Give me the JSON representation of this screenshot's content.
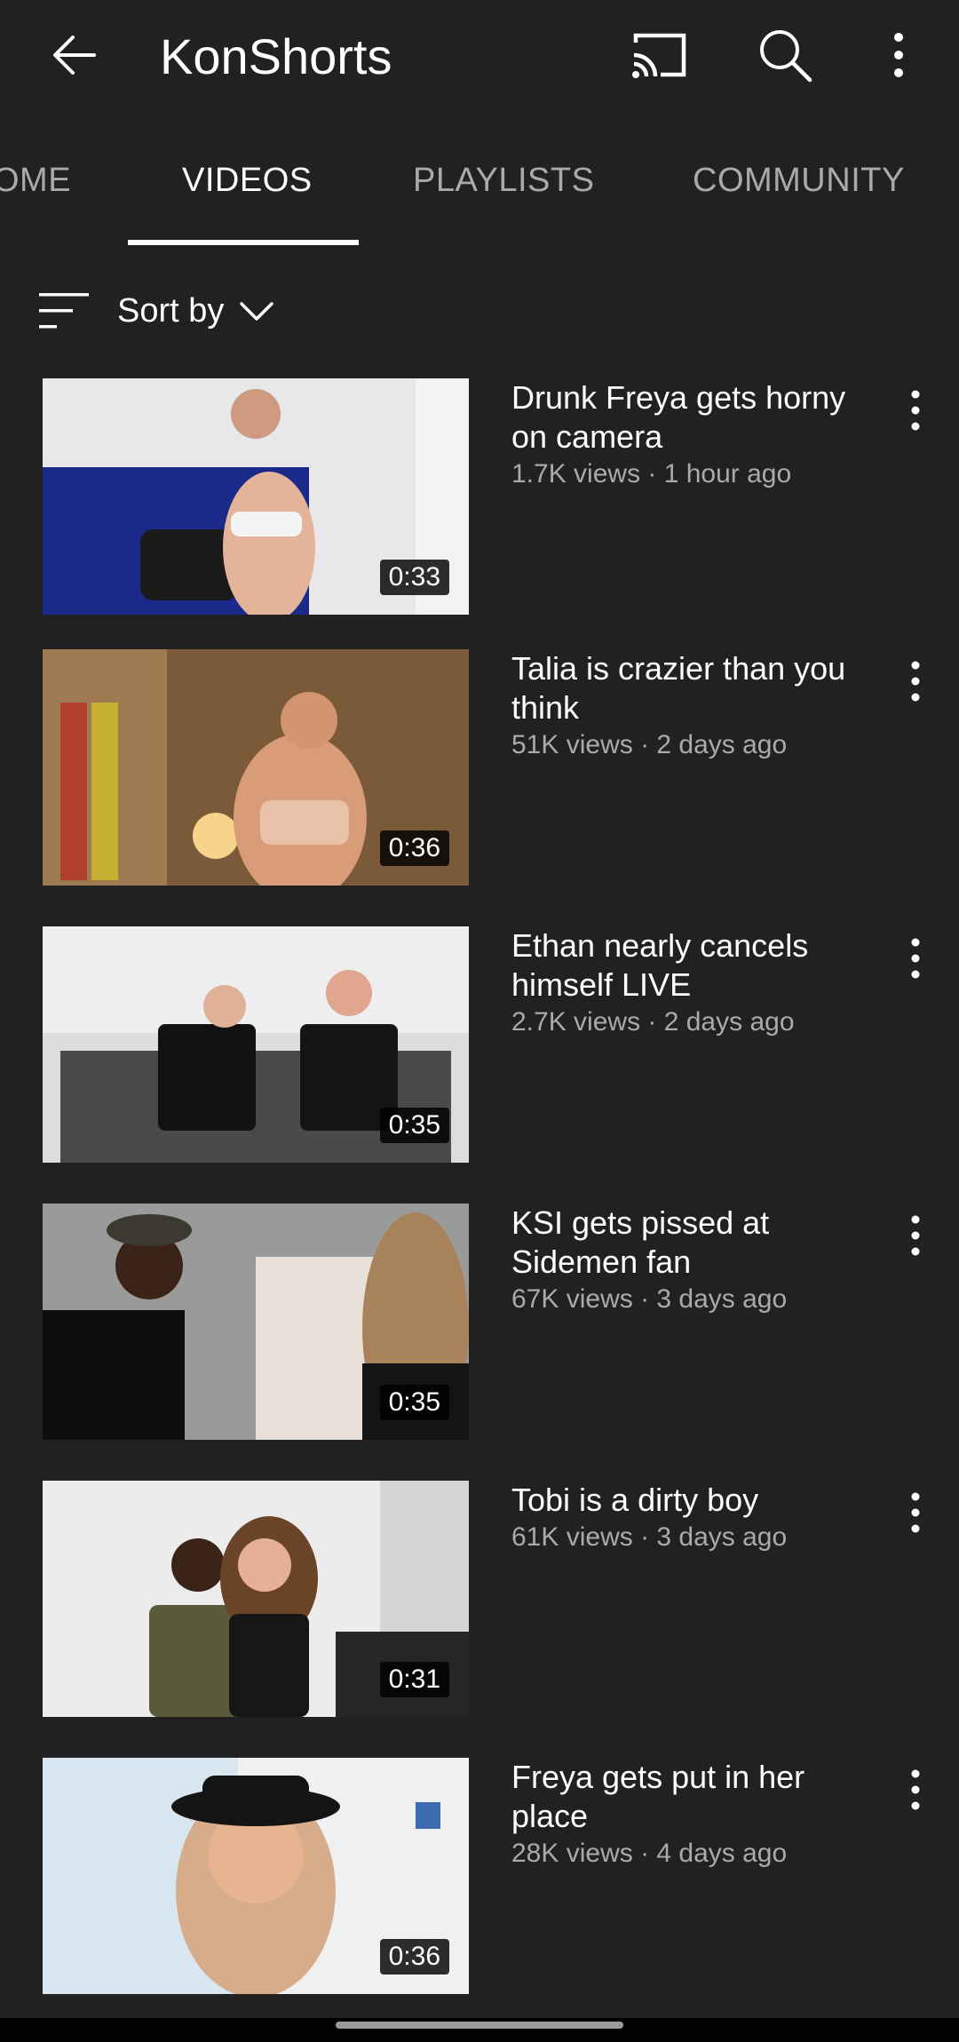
{
  "appbar": {
    "title": "KonShorts",
    "icons": [
      "back-arrow-icon",
      "cast-icon",
      "search-icon",
      "more-vert-icon"
    ]
  },
  "tabs": [
    {
      "label": "OME",
      "active": false
    },
    {
      "label": "VIDEOS",
      "active": true
    },
    {
      "label": "PLAYLISTS",
      "active": false
    },
    {
      "label": "COMMUNITY",
      "active": false
    }
  ],
  "sort": {
    "label": "Sort by"
  },
  "videos": [
    {
      "title": "Drunk Freya gets horny on camera",
      "meta": "1.7K views · 1 hour ago",
      "duration": "0:33"
    },
    {
      "title": "Talia is crazier than you think",
      "meta": "51K views · 2 days ago",
      "duration": "0:36"
    },
    {
      "title": "Ethan nearly cancels himself LIVE",
      "meta": "2.7K views · 2 days ago",
      "duration": "0:35"
    },
    {
      "title": "KSI gets pissed at Sidemen fan",
      "meta": "67K views · 3 days ago",
      "duration": "0:35"
    },
    {
      "title": "Tobi is a dirty boy",
      "meta": "61K views · 3 days ago",
      "duration": "0:31"
    },
    {
      "title": "Freya gets put in her place",
      "meta": "28K views · 4 days ago",
      "duration": "0:36"
    }
  ],
  "colors": {
    "background": "#212121",
    "text_primary": "#ffffff",
    "text_secondary": "#aaaaaa"
  }
}
